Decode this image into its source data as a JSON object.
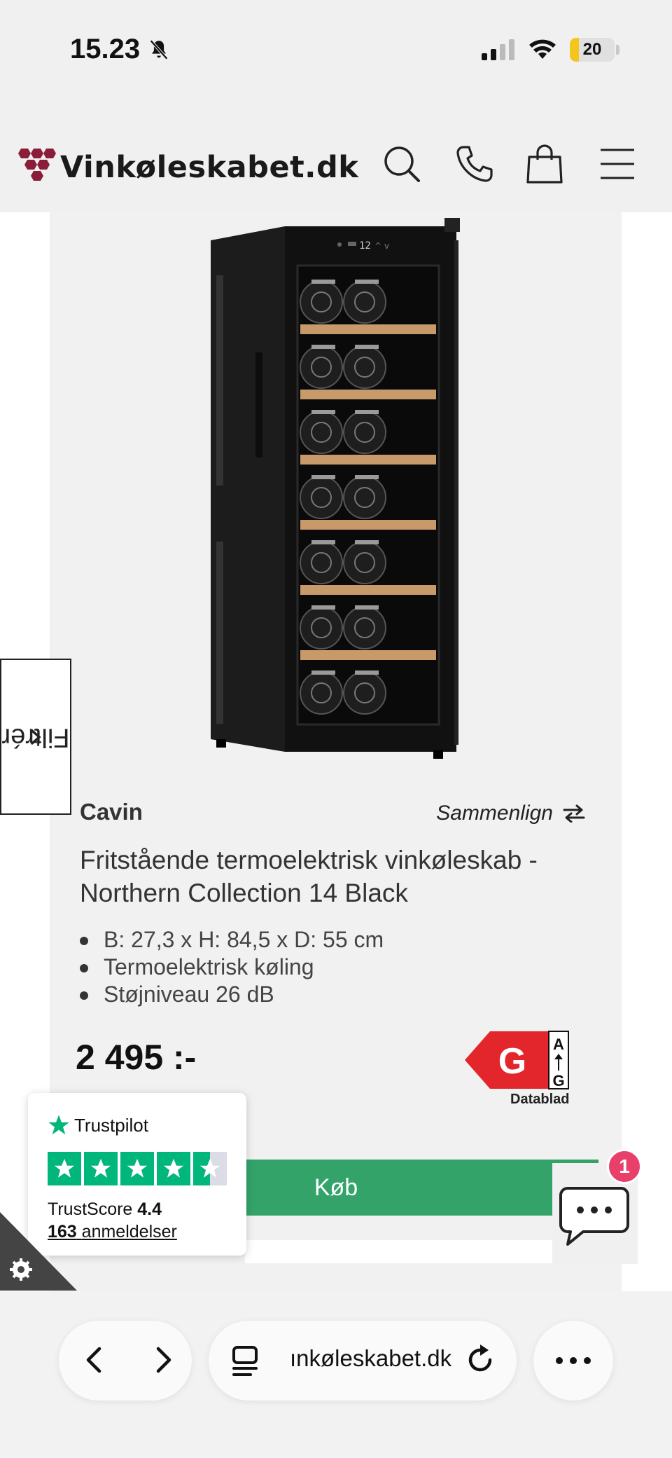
{
  "status_bar": {
    "time": "15.23",
    "battery": "20",
    "battery_level": 0.2
  },
  "header": {
    "logo_text": "Vinkøleskabet.dk"
  },
  "filter": {
    "label": "Filtrér"
  },
  "product": {
    "brand": "Cavin",
    "compare_label": "Sammenlign",
    "title": "Fritstående termoelektrisk vinkøleskab - Northern Collection 14 Black",
    "features": [
      "B: 27,3 x H: 84,5 x D: 55 cm",
      "Termoelektrisk køling",
      "Støjniveau 26 dB"
    ],
    "price": "2 495 :-",
    "energy_class": "G",
    "energy_scale_top": "A",
    "energy_scale_bottom": "G",
    "datasheet_label": "Datablad",
    "buy_label": "Køb",
    "display_temp": "12"
  },
  "chat": {
    "badge": "1"
  },
  "trustpilot": {
    "brand": "Trustpilot",
    "score_label": "TrustScore",
    "score": "4.4",
    "review_count": "163",
    "review_label": "anmeldelser"
  },
  "browser": {
    "url": "ınkøleskabet.dk"
  },
  "colors": {
    "buy": "#33a36a",
    "trustpilot": "#00b67a",
    "energy": "#e3262b",
    "badge": "#e8406a"
  }
}
